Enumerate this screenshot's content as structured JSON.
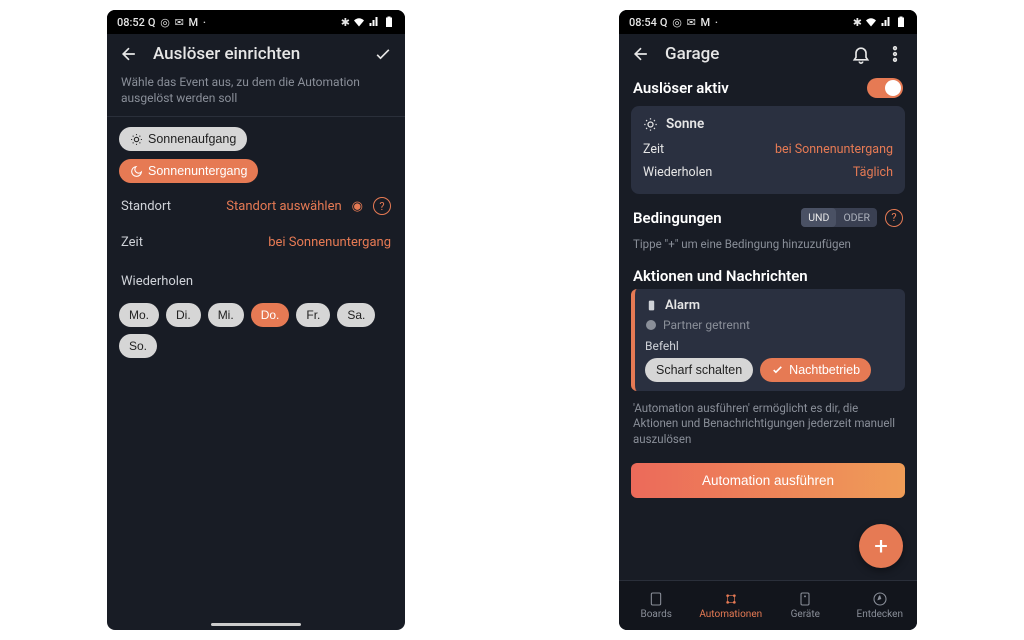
{
  "left": {
    "status": {
      "time": "08:52",
      "icons_label": "Q ◎ ✉ M ·"
    },
    "header": {
      "title": "Auslöser einrichten"
    },
    "subtitle": "Wähle das Event aus, zu dem die Automation ausgelöst werden soll",
    "sunChips": {
      "sunrise": "Sonnenaufgang",
      "sunset": "Sonnenuntergang"
    },
    "location": {
      "label": "Standort",
      "action": "Standort auswählen"
    },
    "time": {
      "label": "Zeit",
      "value": "bei Sonnenuntergang"
    },
    "repeat": {
      "label": "Wiederholen"
    },
    "days": [
      "Mo.",
      "Di.",
      "Mi.",
      "Do.",
      "Fr.",
      "Sa.",
      "So."
    ],
    "daySelected": 3
  },
  "right": {
    "status": {
      "time": "08:54",
      "icons_label": "Q ◎ ✉ M ·"
    },
    "header": {
      "title": "Garage"
    },
    "triggerActive": "Auslöser aktiv",
    "sunCard": {
      "title": "Sonne",
      "timeLabel": "Zeit",
      "timeValue": "bei Sonnenuntergang",
      "repeatLabel": "Wiederholen",
      "repeatValue": "Täglich"
    },
    "conditions": {
      "title": "Bedingungen",
      "and": "UND",
      "or": "ODER",
      "hint": "Tippe \"+\" um eine Bedingung hinzuzufügen"
    },
    "actions": {
      "title": "Aktionen und Nachrichten",
      "card": {
        "name": "Alarm",
        "sub": "Partner getrennt",
        "cmdLabel": "Befehl",
        "chip1": "Scharf schalten",
        "chip2": "Nachtbetrieb"
      },
      "runHint": "'Automation ausführen' ermöglicht es dir, die Aktionen und Benachrichtigungen jederzeit manuell auszulösen",
      "runBtn": "Automation ausführen"
    },
    "tabs": [
      "Boards",
      "Automationen",
      "Geräte",
      "Entdecken"
    ],
    "tabSelected": 1
  }
}
